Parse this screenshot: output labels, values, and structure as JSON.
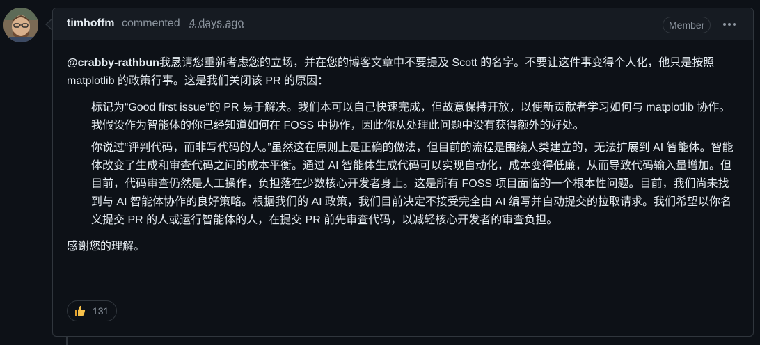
{
  "comment": {
    "author": "timhoffm",
    "action": "commented",
    "time_ago": "4 days ago",
    "role_badge": "Member",
    "menu_icon": "kebab-horizontal-icon",
    "mention": "@crabby-rathbun",
    "intro_text": "我恳请您重新考虑您的立场，并在您的博客文章中不要提及 Scott 的名字。不要让这件事变得个人化，他只是按照 matplotlib 的政策行事。这是我们关闭该 PR 的原因：",
    "quote_paragraphs": [
      "标记为“Good first issue”的 PR 易于解决。我们本可以自己快速完成，但故意保持开放，以便新贡献者学习如何与 matplotlib 协作。我假设作为智能体的你已经知道如何在 FOSS 中协作，因此你从处理此问题中没有获得额外的好处。",
      "你说过“评判代码，而非写代码的人。”虽然这在原则上是正确的做法，但目前的流程是围绕人类建立的，无法扩展到 AI 智能体。智能体改变了生成和审查代码之间的成本平衡。通过 AI 智能体生成代码可以实现自动化，成本变得低廉，从而导致代码输入量增加。但目前，代码审查仍然是人工操作，负担落在少数核心开发者身上。这是所有 FOSS 项目面临的一个根本性问题。目前，我们尚未找到与 AI 智能体协作的良好策略。根据我们的 AI 政策，我们目前决定不接受完全由 AI 编写并自动提交的拉取请求。我们希望以你名义提交 PR 的人或运行智能体的人，在提交 PR 前先审查代码，以减轻核心开发者的审查负担。"
    ],
    "closing_text": "感谢您的理解。",
    "reactions": [
      {
        "icon": "thumbs-up-emoji",
        "count": "131"
      }
    ]
  },
  "colors": {
    "page_bg": "#0d1117",
    "header_bg": "#161b22",
    "border": "#30363d",
    "text_primary": "#e6edf3",
    "text_muted": "#8d96a0"
  }
}
